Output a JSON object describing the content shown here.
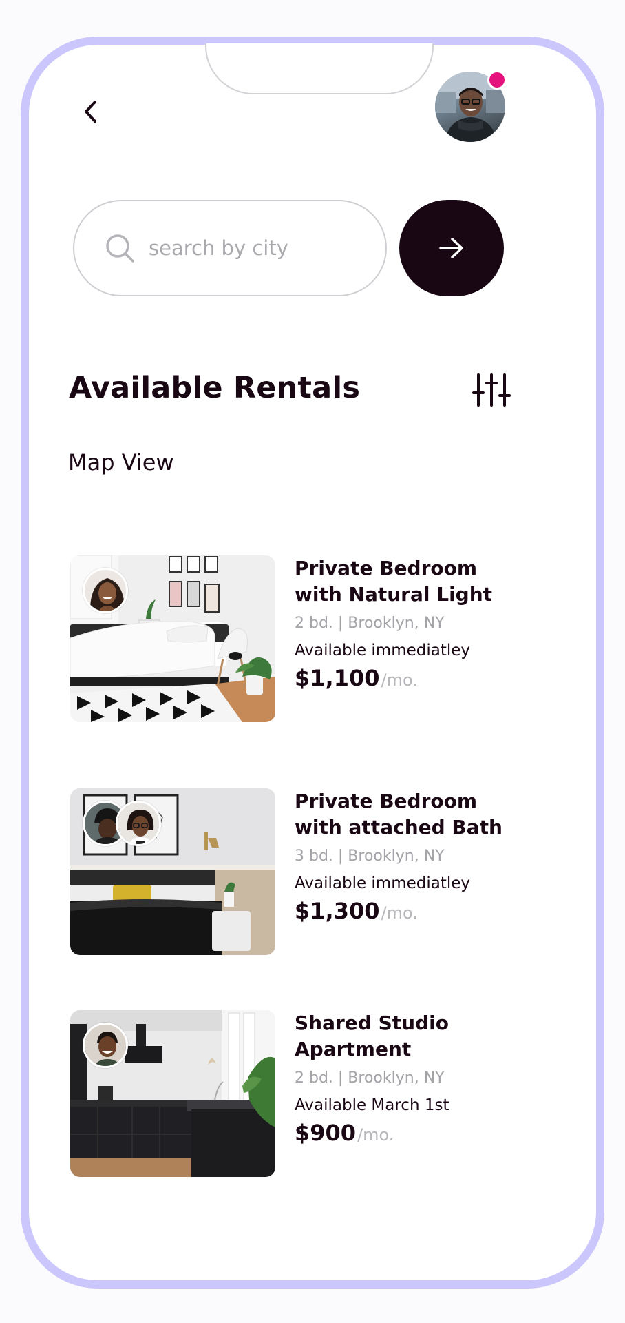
{
  "search": {
    "placeholder": "search by city",
    "icon": "search-icon"
  },
  "header": {
    "back_icon": "chevron-left-icon",
    "has_notification": true,
    "notification_color": "#e3127d"
  },
  "section": {
    "title": "Available Rentals",
    "filter_icon": "sliders-icon",
    "map_view_label": "Map View"
  },
  "listings": [
    {
      "title": "Private Bedroom with Natural Light",
      "meta": "2 bd. | Brooklyn, NY",
      "availability": "Available immediatley",
      "price": "$1,100",
      "per": "/mo."
    },
    {
      "title": "Private Bedroom with attached Bath",
      "meta": "3 bd. | Brooklyn, NY",
      "availability": "Available immediatley",
      "price": "$1,300",
      "per": "/mo."
    },
    {
      "title": "Shared Studio Apartment",
      "meta": "2 bd. | Brooklyn, NY",
      "availability": "Available March 1st",
      "price": "$900",
      "per": "/mo."
    }
  ],
  "colors": {
    "accent": "#1a0714",
    "frame": "#cbc6fb",
    "muted": "#a3a3a8"
  }
}
